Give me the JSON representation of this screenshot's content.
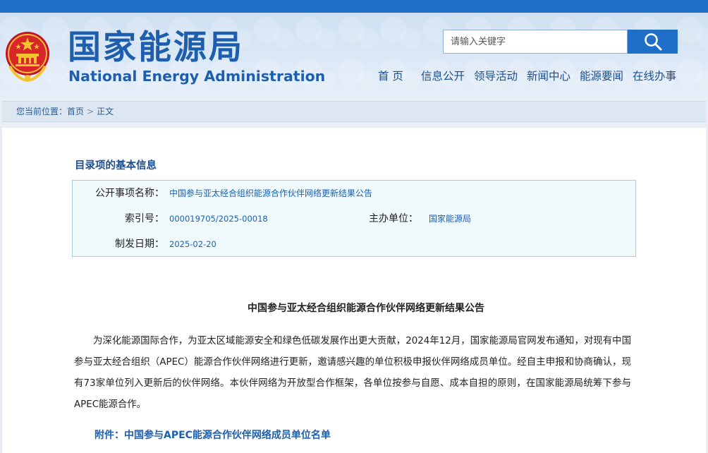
{
  "header": {
    "title_cn": "国家能源局",
    "title_en": "National Energy Administration",
    "emblem": "national-emblem"
  },
  "search": {
    "placeholder": "请输入关键字",
    "button_icon": "search-icon"
  },
  "nav": {
    "items": [
      "首 页",
      "信息公开",
      "领导活动",
      "新闻中心",
      "能源要闻",
      "在线办事"
    ]
  },
  "breadcrumb": {
    "prefix": "您当前位置：",
    "home": "首页",
    "separator": ">",
    "current": "正文"
  },
  "info": {
    "section_title": "目录项的基本信息",
    "name_label": "公开事项名称：",
    "name_value": "中国参与亚太经合组织能源合作伙伴网络更新结果公告",
    "index_label": "索引号：",
    "index_value": "000019705/2025-00018",
    "org_label": "主办单位：",
    "org_value": "国家能源局",
    "date_label": "制发日期：",
    "date_value": "2025-02-20"
  },
  "article": {
    "title": "中国参与亚太经合组织能源合作伙伴网络更新结果公告",
    "body": "为深化能源国际合作，为亚太区域能源安全和绿色低碳发展作出更大贡献，2024年12月，国家能源局官网发布通知，对现有中国参与亚太经合组织（APEC）能源合作伙伴网络进行更新，邀请感兴趣的单位积极申报伙伴网络成员单位。经自主申报和协商确认，现有73家单位列入更新后的伙伴网络。本伙伴网络为开放型合作框架，各单位按参与自愿、成本自担的原则，在国家能源局统筹下参与APEC能源合作。",
    "attachment": "附件：中国参与APEC能源合作伙伴网络成员单位名单"
  },
  "colors": {
    "brand_blue": "#1d5fae",
    "top_strip": "#1f6fc9",
    "info_bg": "#f0fafd",
    "info_border": "#9fd0e4"
  }
}
